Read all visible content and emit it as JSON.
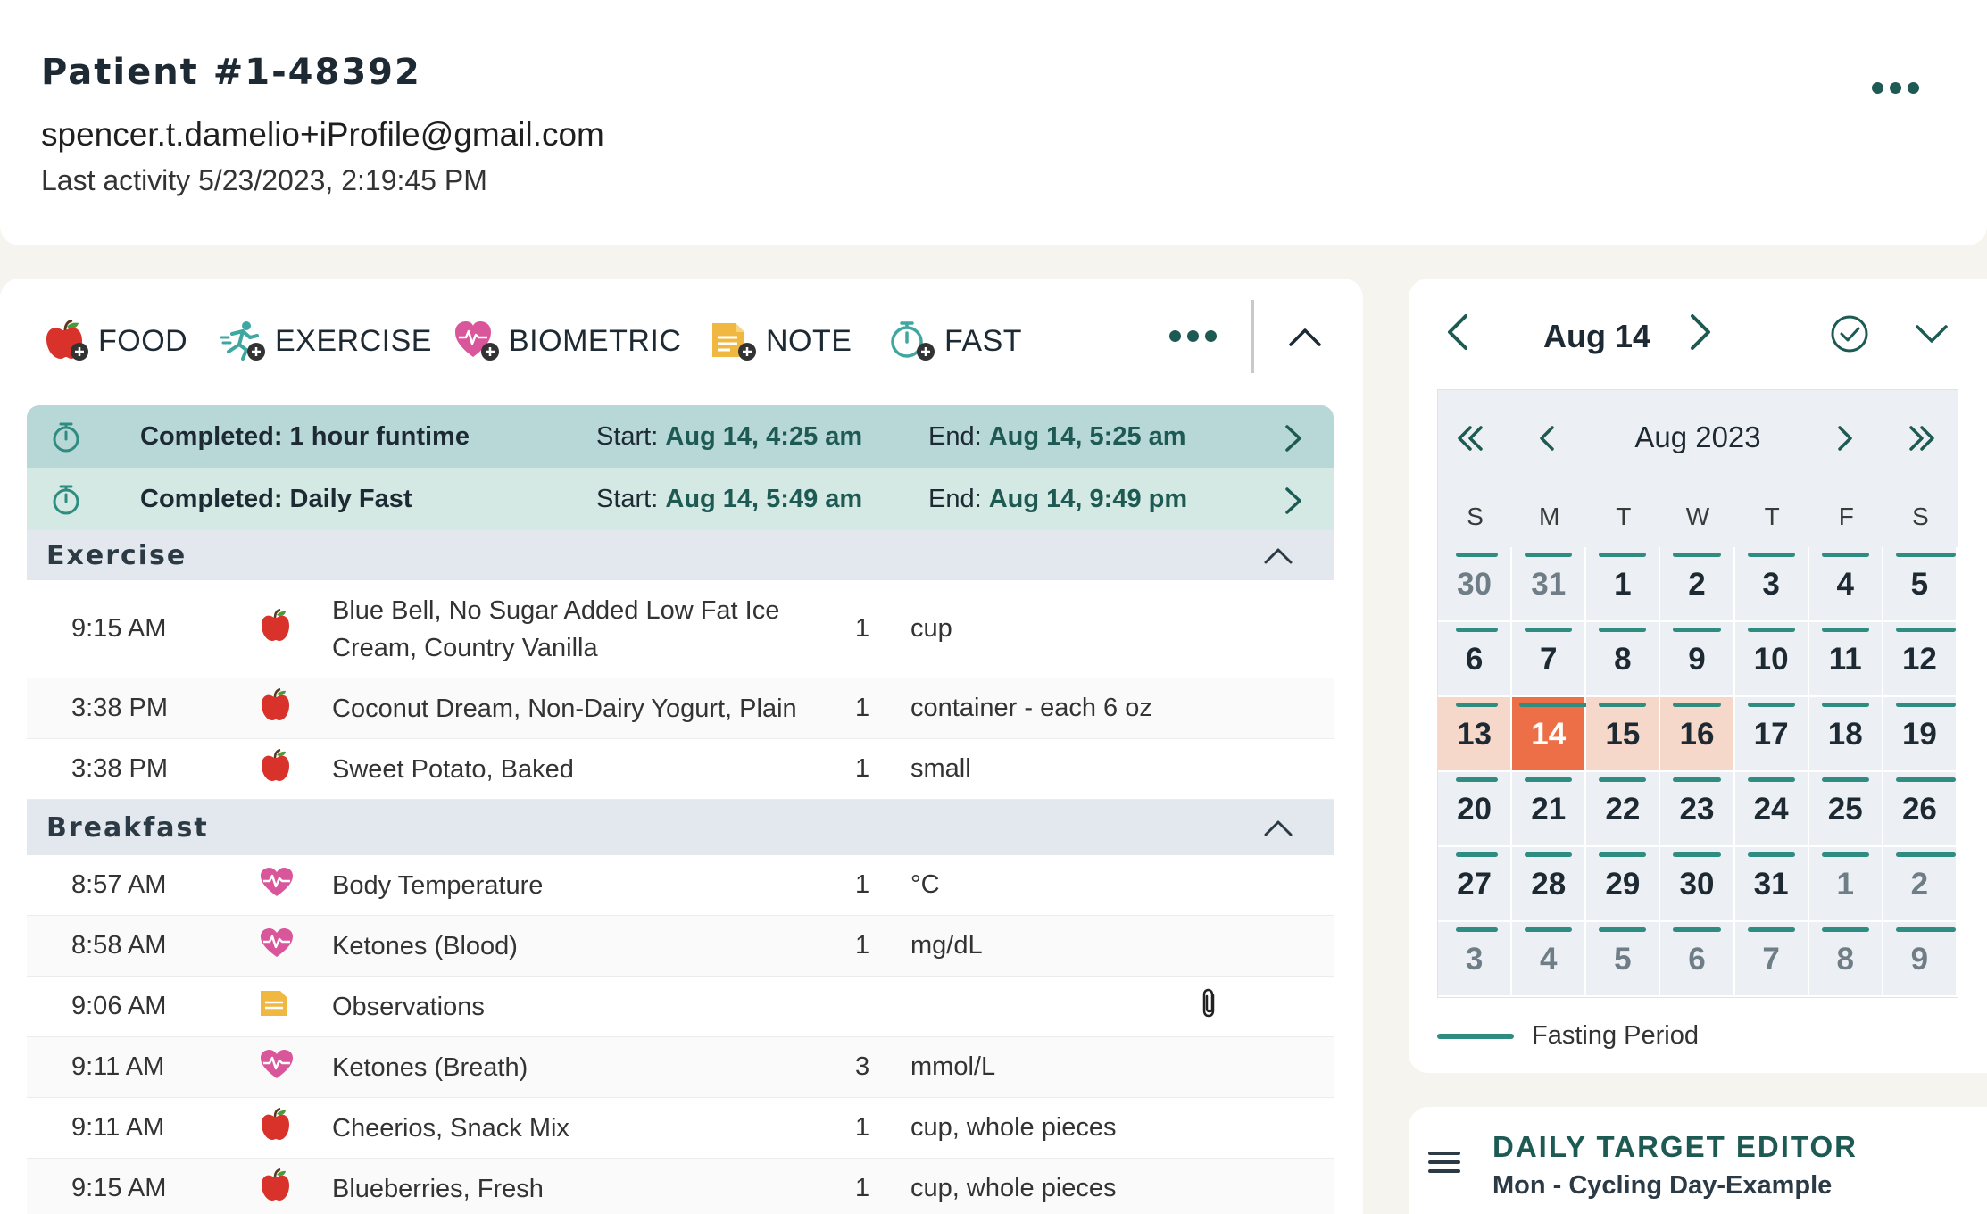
{
  "header": {
    "patient_title": "Patient #1-48392",
    "email": "spencer.t.damelio+iProfile@gmail.com",
    "last_activity": "Last activity 5/23/2023, 2:19:45 PM"
  },
  "toolbar": {
    "food_label": "FOOD",
    "exercise_label": "EXERCISE",
    "biometric_label": "BIOMETRIC",
    "note_label": "NOTE",
    "fast_label": "FAST"
  },
  "fasts": [
    {
      "title": "Completed: 1 hour funtime",
      "start_label": "Start:",
      "start": "Aug 14, 4:25 am",
      "end_label": "End:",
      "end": "Aug 14, 5:25 am"
    },
    {
      "title": "Completed: Daily Fast",
      "start_label": "Start:",
      "start": "Aug 14, 5:49 am",
      "end_label": "End:",
      "end": "Aug 14, 9:49 pm"
    }
  ],
  "sections": {
    "exercise": {
      "title": "Exercise",
      "entries": [
        {
          "time": "9:15 AM",
          "icon": "apple-icon",
          "name": "Blue Bell, No Sugar Added Low Fat Ice Cream, Country Vanilla",
          "qty": "1",
          "unit": "cup"
        },
        {
          "time": "3:38 PM",
          "icon": "apple-icon",
          "name": "Coconut Dream, Non-Dairy Yogurt, Plain",
          "qty": "1",
          "unit": "container - each 6 oz"
        },
        {
          "time": "3:38 PM",
          "icon": "apple-icon",
          "name": "Sweet Potato, Baked",
          "qty": "1",
          "unit": "small"
        }
      ]
    },
    "breakfast": {
      "title": "Breakfast",
      "entries": [
        {
          "time": "8:57 AM",
          "icon": "heart-icon",
          "name": "Body Temperature",
          "qty": "1",
          "unit": "°C"
        },
        {
          "time": "8:58 AM",
          "icon": "heart-icon",
          "name": "Ketones (Blood)",
          "qty": "1",
          "unit": "mg/dL"
        },
        {
          "time": "9:06 AM",
          "icon": "note-icon",
          "name": "Observations",
          "qty": "",
          "unit": ""
        },
        {
          "time": "9:11 AM",
          "icon": "heart-icon",
          "name": "Ketones (Breath)",
          "qty": "3",
          "unit": "mmol/L"
        },
        {
          "time": "9:11 AM",
          "icon": "apple-icon",
          "name": "Cheerios, Snack Mix",
          "qty": "1",
          "unit": "cup, whole pieces"
        },
        {
          "time": "9:15 AM",
          "icon": "apple-icon",
          "name": "Blueberries, Fresh",
          "qty": "1",
          "unit": "cup, whole pieces"
        }
      ]
    }
  },
  "calendar": {
    "header_date": "Aug 14",
    "month_label": "Aug 2023",
    "weekdays": [
      "S",
      "M",
      "T",
      "W",
      "T",
      "F",
      "S"
    ],
    "weeks": [
      [
        "30",
        "31",
        "1",
        "2",
        "3",
        "4",
        "5"
      ],
      [
        "6",
        "7",
        "8",
        "9",
        "10",
        "11",
        "12"
      ],
      [
        "13",
        "14",
        "15",
        "16",
        "17",
        "18",
        "19"
      ],
      [
        "20",
        "21",
        "22",
        "23",
        "24",
        "25",
        "26"
      ],
      [
        "27",
        "28",
        "29",
        "30",
        "31",
        "1",
        "2"
      ],
      [
        "3",
        "4",
        "5",
        "6",
        "7",
        "8",
        "9"
      ]
    ],
    "muted_cells": [
      "0-0",
      "0-1",
      "4-5",
      "4-6",
      "5-0",
      "5-1",
      "5-2",
      "5-3",
      "5-4",
      "5-5",
      "5-6"
    ],
    "selected_cell": "2-1",
    "range_cells": [
      "2-0",
      "2-2",
      "2-3"
    ],
    "legend_label": "Fasting Period",
    "colors": {
      "fasting": "#2f8c80",
      "selected": "#ec6f47",
      "range": "#f6d8cb"
    }
  },
  "target": {
    "title": "DAILY TARGET EDITOR",
    "subtitle": "Mon - Cycling Day-Example"
  }
}
